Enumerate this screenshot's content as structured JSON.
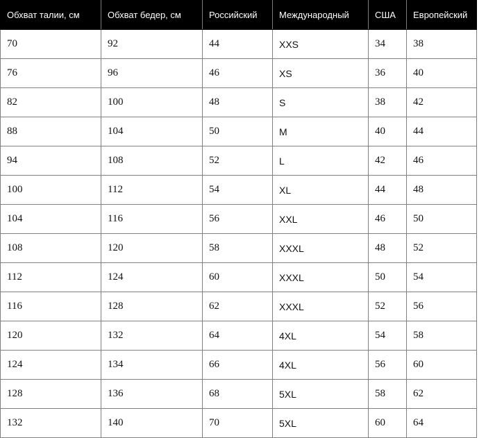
{
  "table": {
    "columns": [
      {
        "key": "waist",
        "label": "Обхват талии, см"
      },
      {
        "key": "hips",
        "label": "Обхват бедер, см"
      },
      {
        "key": "ru",
        "label": "Российский"
      },
      {
        "key": "intl",
        "label": "Международный"
      },
      {
        "key": "usa",
        "label": "США"
      },
      {
        "key": "eu",
        "label": "Европейский"
      }
    ],
    "rows": [
      {
        "waist": "70",
        "hips": "92",
        "ru": "44",
        "intl": "XXS",
        "usa": "34",
        "eu": "38"
      },
      {
        "waist": "76",
        "hips": "96",
        "ru": "46",
        "intl": "XS",
        "usa": "36",
        "eu": "40"
      },
      {
        "waist": "82",
        "hips": "100",
        "ru": "48",
        "intl": "S",
        "usa": "38",
        "eu": "42"
      },
      {
        "waist": "88",
        "hips": "104",
        "ru": "50",
        "intl": "M",
        "usa": "40",
        "eu": "44"
      },
      {
        "waist": "94",
        "hips": "108",
        "ru": "52",
        "intl": "L",
        "usa": "42",
        "eu": "46"
      },
      {
        "waist": "100",
        "hips": "112",
        "ru": "54",
        "intl": "XL",
        "usa": "44",
        "eu": "48"
      },
      {
        "waist": "104",
        "hips": "116",
        "ru": "56",
        "intl": "XXL",
        "usa": "46",
        "eu": "50"
      },
      {
        "waist": "108",
        "hips": "120",
        "ru": "58",
        "intl": "XXXL",
        "usa": "48",
        "eu": "52"
      },
      {
        "waist": "112",
        "hips": "124",
        "ru": "60",
        "intl": "XXXL",
        "usa": "50",
        "eu": "54"
      },
      {
        "waist": "116",
        "hips": "128",
        "ru": "62",
        "intl": "XXXL",
        "usa": "52",
        "eu": "56"
      },
      {
        "waist": "120",
        "hips": "132",
        "ru": "64",
        "intl": "4XL",
        "usa": "54",
        "eu": "58"
      },
      {
        "waist": "124",
        "hips": "134",
        "ru": "66",
        "intl": "4XL",
        "usa": "56",
        "eu": "60"
      },
      {
        "waist": "128",
        "hips": "136",
        "ru": "68",
        "intl": "5XL",
        "usa": "58",
        "eu": "62"
      },
      {
        "waist": "132",
        "hips": "140",
        "ru": "70",
        "intl": "5XL",
        "usa": "60",
        "eu": "64"
      }
    ]
  },
  "colors": {
    "header_background": "#000000",
    "header_text": "#ffffff",
    "cell_background": "#ffffff",
    "cell_text": "#111111",
    "grid_line": "#808080"
  }
}
